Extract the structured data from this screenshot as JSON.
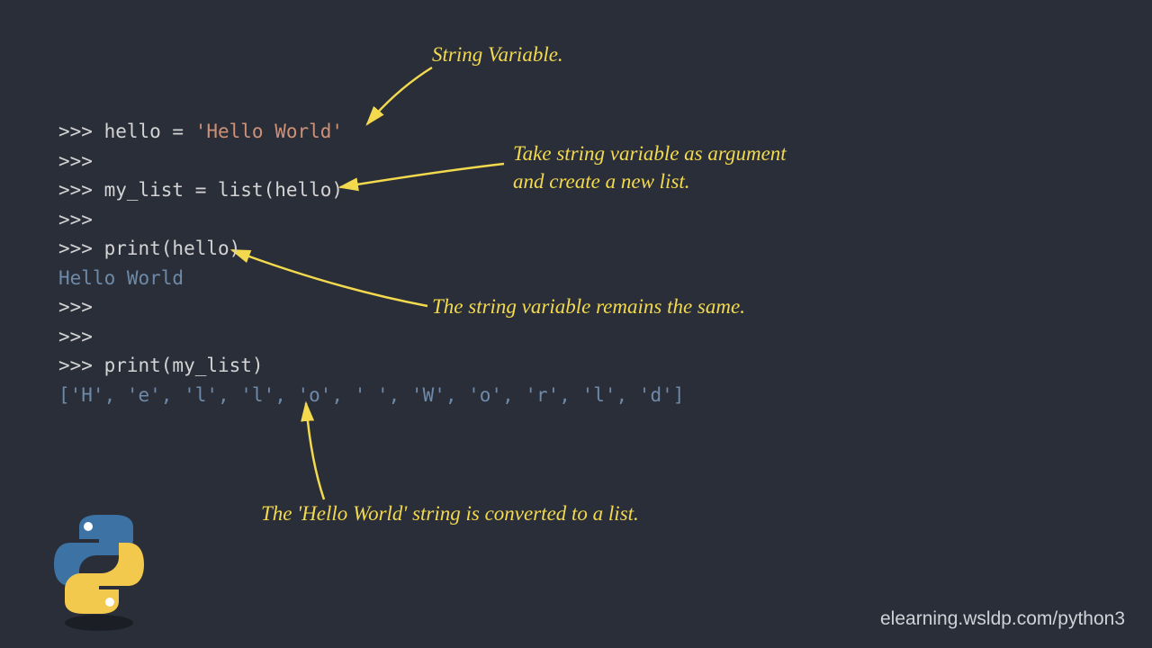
{
  "annotations": {
    "string_variable": "String Variable.",
    "take_arg_line1": "Take string variable as argument",
    "take_arg_line2": "and create a new list.",
    "remains_same": "The string variable remains the same.",
    "converted": "The 'Hello World' string is converted to a list."
  },
  "code": {
    "l1a": ">>> hello = ",
    "l1b": "'Hello World'",
    "l2": ">>>",
    "l3": ">>> my_list = list(hello)",
    "l4": ">>>",
    "l5": ">>> print(hello)",
    "l6": "Hello World",
    "l7": ">>>",
    "l8": ">>>",
    "l9": ">>> print(my_list)",
    "l10": "['H', 'e', 'l', 'l', 'o', ' ', 'W', 'o', 'r', 'l', 'd']"
  },
  "footer": "elearning.wsldp.com/python3"
}
